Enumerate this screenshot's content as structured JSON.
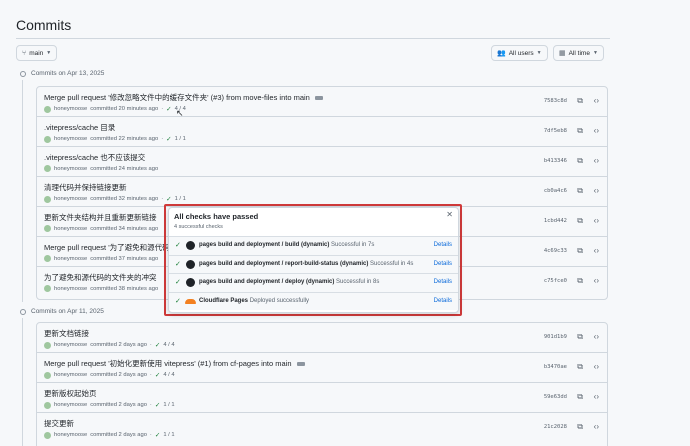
{
  "page_title": "Commits",
  "toolbar": {
    "branch_label": "main",
    "users_label": "All users",
    "time_label": "All time"
  },
  "day_groups": [
    {
      "header": "Commits on Apr 13, 2025",
      "commits": [
        {
          "message": "Merge pull request '修改忽略文件中的缓存文件夹' (#3) from move-files into main",
          "ellipsis": true,
          "author": "honeymoose",
          "time": "committed 20 minutes ago",
          "checks": "4 / 4",
          "sha": "7583c8d"
        },
        {
          "message": ".vitepress/cache 目录",
          "ellipsis": false,
          "author": "honeymoose",
          "time": "committed 22 minutes ago",
          "checks": "1 / 1",
          "sha": "7df5eb8"
        },
        {
          "message": ".vitepress/cache 也不应该提交",
          "ellipsis": false,
          "author": "honeymoose",
          "time": "committed 24 minutes ago",
          "checks": "",
          "sha": "b413346"
        },
        {
          "message": "清理代码并保持链接更新",
          "ellipsis": false,
          "author": "honeymoose",
          "time": "committed 32 minutes ago",
          "checks": "1 / 1",
          "sha": "cb0a4c6"
        },
        {
          "message": "更新文件夹结构并且重新更新链接",
          "ellipsis": false,
          "author": "honeymoose",
          "time": "committed 34 minutes ago",
          "checks": "",
          "sha": "1cbd442"
        },
        {
          "message": "Merge pull request '为了避免和源代码",
          "ellipsis": false,
          "author": "honeymoose",
          "time": "committed 37 minutes ago",
          "checks": "",
          "sha": "4c69c33"
        },
        {
          "message": "为了避免和源代码的文件夹的冲突",
          "ellipsis": false,
          "author": "honeymoose",
          "time": "committed 38 minutes ago",
          "checks": "",
          "sha": "c75fce0"
        }
      ]
    },
    {
      "header": "Commits on Apr 11, 2025",
      "commits": [
        {
          "message": "更新文档链接",
          "ellipsis": false,
          "author": "honeymoose",
          "time": "committed 2 days ago",
          "checks": "4 / 4",
          "sha": "901d1b9"
        },
        {
          "message": "Merge pull request '初始化更新使用 vitepress' (#1) from cf-pages into main",
          "ellipsis": true,
          "author": "honeymoose",
          "time": "committed 2 days ago",
          "checks": "4 / 4",
          "sha": "b3470ae"
        },
        {
          "message": "更新版权起始页",
          "ellipsis": false,
          "author": "honeymoose",
          "time": "committed 2 days ago",
          "checks": "1 / 1",
          "sha": "59e63dd"
        },
        {
          "message": "提交更新",
          "ellipsis": false,
          "author": "honeymoose",
          "time": "committed 2 days ago",
          "checks": "1 / 1",
          "sha": "21c2028"
        }
      ]
    }
  ],
  "popup": {
    "title": "All checks have passed",
    "subtitle": "4 successful checks",
    "checks": [
      {
        "name": "pages build and deployment / build (dynamic)",
        "status": "Successful in 7s",
        "details": "Details",
        "icon": "github-icon"
      },
      {
        "name": "pages build and deployment / report-build-status (dynamic)",
        "status": "Successful in 4s",
        "details": "Details",
        "icon": "github-icon"
      },
      {
        "name": "pages build and deployment / deploy (dynamic)",
        "status": "Successful in 8s",
        "details": "Details",
        "icon": "github-icon"
      },
      {
        "name": "Cloudflare Pages",
        "status": "Deployed successfully",
        "details": "Details",
        "icon": "cloudflare-icon"
      }
    ]
  },
  "colors": {
    "accent": "#0969da",
    "success": "#1a7f37",
    "highlight_border": "#d03a3a"
  }
}
